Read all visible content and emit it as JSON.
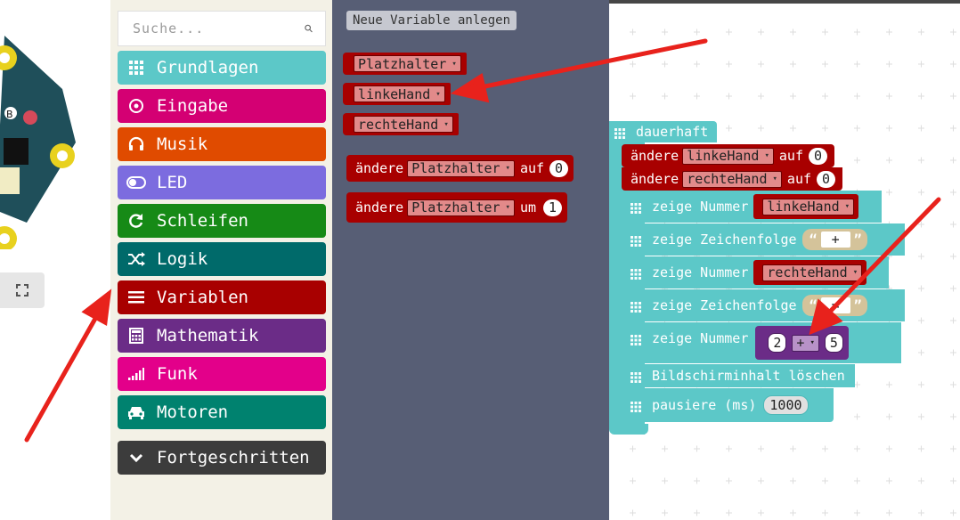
{
  "search": {
    "placeholder": "Suche..."
  },
  "categories": [
    {
      "label": "Grundlagen",
      "icon": "grid-icon",
      "color": "#5cc8c8"
    },
    {
      "label": "Eingabe",
      "icon": "target-icon",
      "color": "#d40073"
    },
    {
      "label": "Musik",
      "icon": "headphones-icon",
      "color": "#e04b00"
    },
    {
      "label": "LED",
      "icon": "toggle-icon",
      "color": "#7c6cdf"
    },
    {
      "label": "Schleifen",
      "icon": "refresh-icon",
      "color": "#168a16"
    },
    {
      "label": "Logik",
      "icon": "shuffle-icon",
      "color": "#006a6a"
    },
    {
      "label": "Variablen",
      "icon": "list-icon",
      "color": "#a80000"
    },
    {
      "label": "Mathematik",
      "icon": "calculator-icon",
      "color": "#6b2c87"
    },
    {
      "label": "Funk",
      "icon": "signal-icon",
      "color": "#e3008a"
    },
    {
      "label": "Motoren",
      "icon": "car-icon",
      "color": "#00826f"
    },
    {
      "label": "Fortgeschritten",
      "icon": "chevron-down-icon",
      "color": "#3c3c3c"
    }
  ],
  "flyout": {
    "new_variable": "Neue Variable anlegen",
    "variables": [
      "Platzhalter",
      "linkeHand",
      "rechteHand"
    ],
    "set_block": {
      "kw": "ändere",
      "var": "Platzhalter",
      "op": "auf",
      "value": "0"
    },
    "change_block": {
      "kw": "ändere",
      "var": "Platzhalter",
      "op": "um",
      "value": "1"
    }
  },
  "program": {
    "hat": "dauerhaft",
    "set1": {
      "kw": "ändere",
      "var": "linkeHand",
      "op": "auf",
      "value": "0"
    },
    "set2": {
      "kw": "ändere",
      "var": "rechteHand",
      "op": "auf",
      "value": "0"
    },
    "show_num1": {
      "label": "zeige Nummer",
      "var": "linkeHand"
    },
    "show_str1": {
      "label": "zeige Zeichenfolge",
      "open": "“",
      "value": "+",
      "close": "”"
    },
    "show_num2": {
      "label": "zeige Nummer",
      "var": "rechteHand"
    },
    "show_str2": {
      "label": "zeige Zeichenfolge",
      "open": "“",
      "value": "=",
      "close": "”"
    },
    "show_num3": {
      "label": "zeige Nummer",
      "a": "2",
      "op": "+",
      "b": "5"
    },
    "clear": {
      "label": "Bildschirminhalt löschen"
    },
    "pause": {
      "label": "pausiere (ms)",
      "value": "1000"
    }
  },
  "dropdown_glyph": "▾"
}
